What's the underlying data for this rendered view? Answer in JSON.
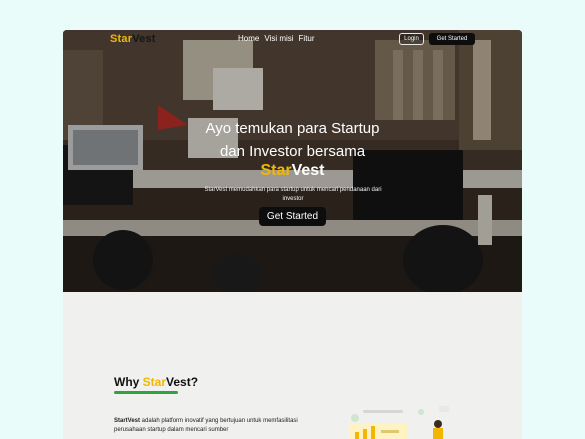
{
  "navbar": {
    "logo": {
      "part1": "Star",
      "part2": "Vest"
    },
    "links": [
      {
        "label": "Home"
      },
      {
        "label": "Visi misi"
      },
      {
        "label": "Fitur"
      }
    ],
    "login_label": "Login",
    "get_started_label": "Get Started"
  },
  "hero": {
    "title_line1": "Ayo temukan para Startup",
    "title_line2": "dan Investor bersama",
    "brand": {
      "part1": "Star",
      "part2": "Vest"
    },
    "subtitle": "StarVest memudahkan para startup untuk mencari pendanaan dari investor",
    "cta_label": "Get Started"
  },
  "why": {
    "title_prefix": "Why ",
    "title_brand1": "Star",
    "title_brand2": "Vest?",
    "text_bold": "StartVest",
    "text_rest": " adalah platform inovatif yang bertujuan untuk memfasilitasi perusahaan startup dalam mencari sumber"
  },
  "colors": {
    "brand_yellow": "#f2b705",
    "brand_green": "#2fa43b",
    "button_dark": "#0d0d0d",
    "page_bg": "#eafcfa",
    "section_bg": "#f0f0ef"
  }
}
